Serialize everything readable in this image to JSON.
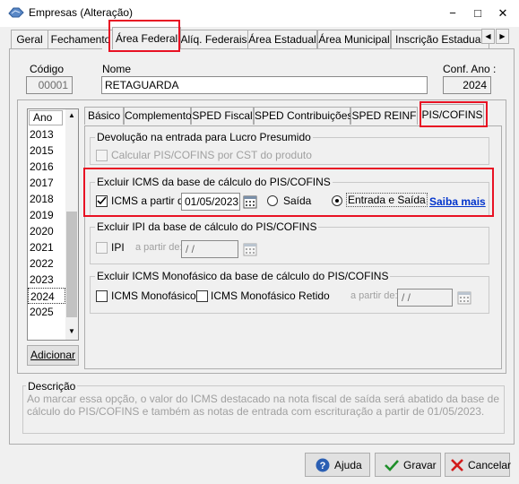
{
  "window": {
    "title": "Empresas (Alteração)",
    "minimize": "−",
    "maximize": "□",
    "close": "✕"
  },
  "top_tabs": [
    {
      "label": "Geral"
    },
    {
      "label": "Fechamento"
    },
    {
      "label": "Área Federal",
      "active": true
    },
    {
      "label": "Alíq. Federais"
    },
    {
      "label": "Área Estadual"
    },
    {
      "label": "Área Municipal"
    },
    {
      "label": "Inscrição Estadual S"
    }
  ],
  "header": {
    "codigo_label": "Código",
    "codigo_value": "00001",
    "nome_label": "Nome",
    "nome_value": "RETAGUARDA",
    "conf_ano_label": "Conf. Ano :",
    "conf_ano_value": "2024"
  },
  "year_list": {
    "header": "Ano",
    "years": [
      "2013",
      "2015",
      "2016",
      "2017",
      "2018",
      "2019",
      "2020",
      "2021",
      "2022",
      "2023",
      "2024",
      "2025"
    ],
    "selected": "2024",
    "add_button": "Adicionar"
  },
  "inner_tabs": [
    {
      "label": "Básico"
    },
    {
      "label": "Complemento"
    },
    {
      "label": "SPED Fiscal"
    },
    {
      "label": "SPED Contribuições"
    },
    {
      "label": "SPED REINF"
    },
    {
      "label": "PIS/COFINS",
      "active": true
    }
  ],
  "devolucao": {
    "title": "Devolução na entrada para Lucro Presumido",
    "checkbox_label": "Calcular PIS/COFINS por CST do produto",
    "checked": false
  },
  "excluir_icms": {
    "title": "Excluir ICMS da base de cálculo do PIS/COFINS",
    "checkbox_label": "ICMS a partir de:",
    "checked": true,
    "date": "01/05/2023",
    "radio_saida": "Saída",
    "radio_entrada_saida": "Entrada e Saída",
    "selected_radio": "entrada_saida",
    "saiba_mais": "Saiba mais"
  },
  "excluir_ipi": {
    "title": "Excluir IPI da base de cálculo do PIS/COFINS",
    "checkbox_label": "IPI",
    "checked": false,
    "date_label": "a partir de:",
    "date": "/ /"
  },
  "excluir_icms_mono": {
    "title": "Excluir ICMS Monofásico da base de cálculo do PIS/COFINS",
    "chk1_label": "ICMS Monofásico",
    "chk2_label": "ICMS Monofásico Retido",
    "date_label": "a partir de:",
    "date": "/ /"
  },
  "descricao": {
    "title": "Descrição",
    "text": "Ao marcar essa opção, o valor do ICMS destacado na nota fiscal de saída será abatido da base de cálculo do PIS/COFINS e também as notas de entrada com escrituração a partir de 01/05/2023."
  },
  "footer": {
    "ajuda": "Ajuda",
    "gravar": "Gravar",
    "cancelar": "Cancelar"
  },
  "colors": {
    "highlight_red": "#e81123",
    "link_blue": "#0033cc",
    "selected_bg": "#ffffff"
  }
}
